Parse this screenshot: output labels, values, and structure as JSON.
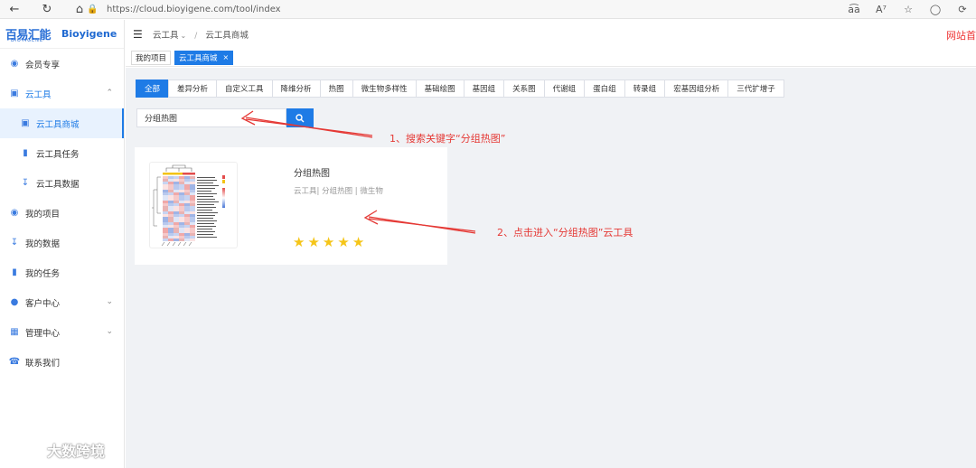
{
  "browser": {
    "url": "https://cloud.bioyigene.com/tool/index",
    "icons": [
      "back-icon",
      "refresh-icon",
      "home-icon",
      "lock-icon",
      "read-aloud-icon",
      "font-icon",
      "favorite-icon",
      "profile-icon",
      "extensions-icon"
    ]
  },
  "logo": {
    "mark_text": "百易汇能",
    "mark_sub": "BIOYIGENE",
    "brand": "Bioyigene"
  },
  "sidebar": {
    "items": [
      {
        "label": "会员专享",
        "icon": "vip-icon"
      },
      {
        "label": "云工具",
        "icon": "cloud-tool-icon",
        "expanded": true
      },
      {
        "label": "云工具商城",
        "icon": "store-icon",
        "sub": true,
        "active": true
      },
      {
        "label": "云工具任务",
        "icon": "task-doc-icon",
        "sub": true
      },
      {
        "label": "云工具数据",
        "icon": "data-icon",
        "sub": true
      },
      {
        "label": "我的项目",
        "icon": "project-icon"
      },
      {
        "label": "我的数据",
        "icon": "my-data-icon"
      },
      {
        "label": "我的任务",
        "icon": "my-task-icon"
      },
      {
        "label": "客户中心",
        "icon": "customer-icon",
        "has_children": true
      },
      {
        "label": "管理中心",
        "icon": "manage-icon",
        "has_children": true
      },
      {
        "label": "联系我们",
        "icon": "phone-icon"
      }
    ]
  },
  "header": {
    "breadcrumb_root": "云工具",
    "breadcrumb_sep": "/",
    "breadcrumb_current": "云工具商城",
    "site_text": "网站首"
  },
  "tabs": [
    {
      "label": "我的项目",
      "active": false
    },
    {
      "label": "云工具商城",
      "active": true,
      "closable": true
    }
  ],
  "filters": [
    "全部",
    "差异分析",
    "自定义工具",
    "降维分析",
    "热图",
    "微生物多样性",
    "基础绘图",
    "基因组",
    "关系图",
    "代谢组",
    "蛋白组",
    "转录组",
    "宏基因组分析",
    "三代扩增子"
  ],
  "active_filter": "全部",
  "search": {
    "value": "分组热图"
  },
  "card": {
    "title": "分组热图",
    "tags": "云工具| 分组热图 | 微生物",
    "rating": 5
  },
  "annotations": {
    "step1": "1、搜索关键字“分组热图”",
    "step2": "2、点击进入“分组热图”云工具",
    "color": "#e53935"
  },
  "watermark": "大数跨境",
  "colors": {
    "accent": "#1e7be6",
    "star": "#f5c518",
    "annotation": "#e53935"
  }
}
